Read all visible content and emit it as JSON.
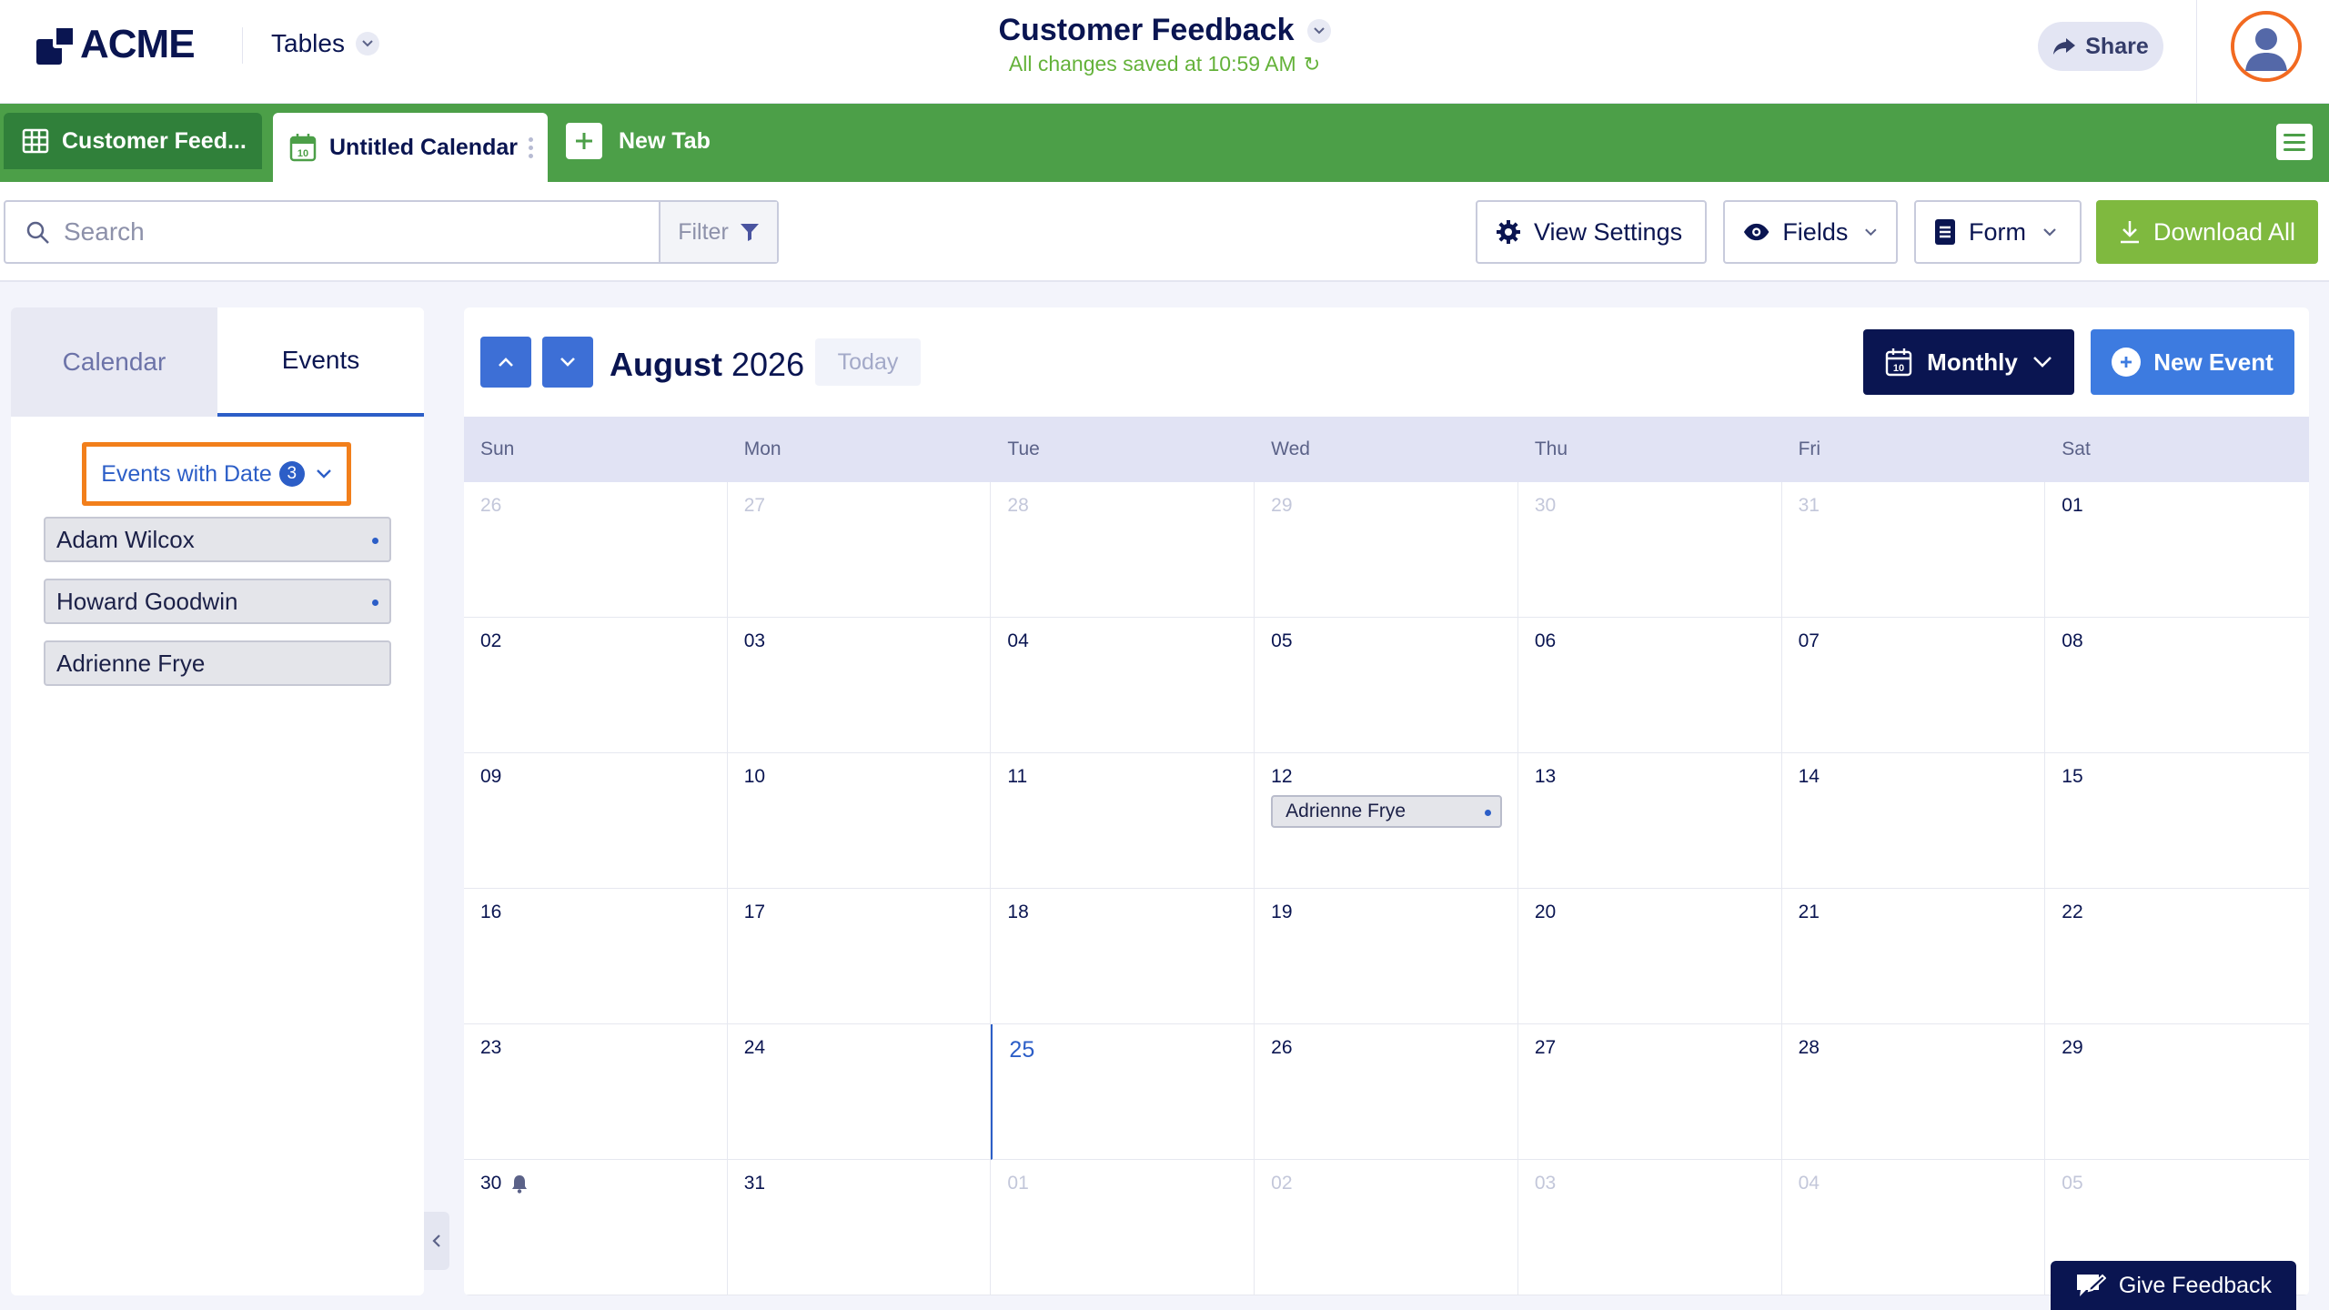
{
  "app": {
    "logo_text": "ACME",
    "tables_label": "Tables",
    "title": "Customer Feedback",
    "save_status": "All changes saved at 10:59 AM",
    "share_label": "Share"
  },
  "tabs": [
    {
      "label": "Customer Feed..."
    },
    {
      "label": "Untitled Calendar"
    },
    {
      "label": "New Tab"
    }
  ],
  "toolbar": {
    "search_placeholder": "Search",
    "filter_label": "Filter",
    "view_settings_label": "View Settings",
    "fields_label": "Fields",
    "form_label": "Form",
    "download_label": "Download All"
  },
  "sidebar": {
    "tab_calendar": "Calendar",
    "tab_events": "Events",
    "filter_label": "Events with Date",
    "filter_count": "3",
    "events": [
      {
        "name": "Adam Wilcox"
      },
      {
        "name": "Howard Goodwin"
      },
      {
        "name": "Adrienne Frye"
      }
    ]
  },
  "calendar": {
    "month": "August",
    "year": "2026",
    "today_label": "Today",
    "view_label": "Monthly",
    "new_event_label": "New Event",
    "days_of_week": [
      "Sun",
      "Mon",
      "Tue",
      "Wed",
      "Thu",
      "Fri",
      "Sat"
    ],
    "cells": [
      {
        "d": "26",
        "muted": true
      },
      {
        "d": "27",
        "muted": true
      },
      {
        "d": "28",
        "muted": true
      },
      {
        "d": "29",
        "muted": true
      },
      {
        "d": "30",
        "muted": true
      },
      {
        "d": "31",
        "muted": true
      },
      {
        "d": "01"
      },
      {
        "d": "02"
      },
      {
        "d": "03"
      },
      {
        "d": "04"
      },
      {
        "d": "05"
      },
      {
        "d": "06"
      },
      {
        "d": "07"
      },
      {
        "d": "08"
      },
      {
        "d": "09"
      },
      {
        "d": "10"
      },
      {
        "d": "11"
      },
      {
        "d": "12",
        "event": "Adrienne Frye"
      },
      {
        "d": "13"
      },
      {
        "d": "14"
      },
      {
        "d": "15"
      },
      {
        "d": "16"
      },
      {
        "d": "17"
      },
      {
        "d": "18"
      },
      {
        "d": "19"
      },
      {
        "d": "20"
      },
      {
        "d": "21"
      },
      {
        "d": "22"
      },
      {
        "d": "23"
      },
      {
        "d": "24"
      },
      {
        "d": "25",
        "today": true
      },
      {
        "d": "26"
      },
      {
        "d": "27"
      },
      {
        "d": "28"
      },
      {
        "d": "29"
      },
      {
        "d": "30",
        "bell": true
      },
      {
        "d": "31"
      },
      {
        "d": "01",
        "muted": true
      },
      {
        "d": "02",
        "muted": true
      },
      {
        "d": "03",
        "muted": true
      },
      {
        "d": "04",
        "muted": true
      },
      {
        "d": "05",
        "muted": true
      }
    ]
  },
  "feedback_label": "Give Feedback",
  "colors": {
    "brand_navy": "#0a1551",
    "tab_green": "#4c9f48",
    "accent_blue": "#2c5ec7",
    "highlight_orange": "#f27f1b",
    "download_green": "#7fb93f"
  }
}
